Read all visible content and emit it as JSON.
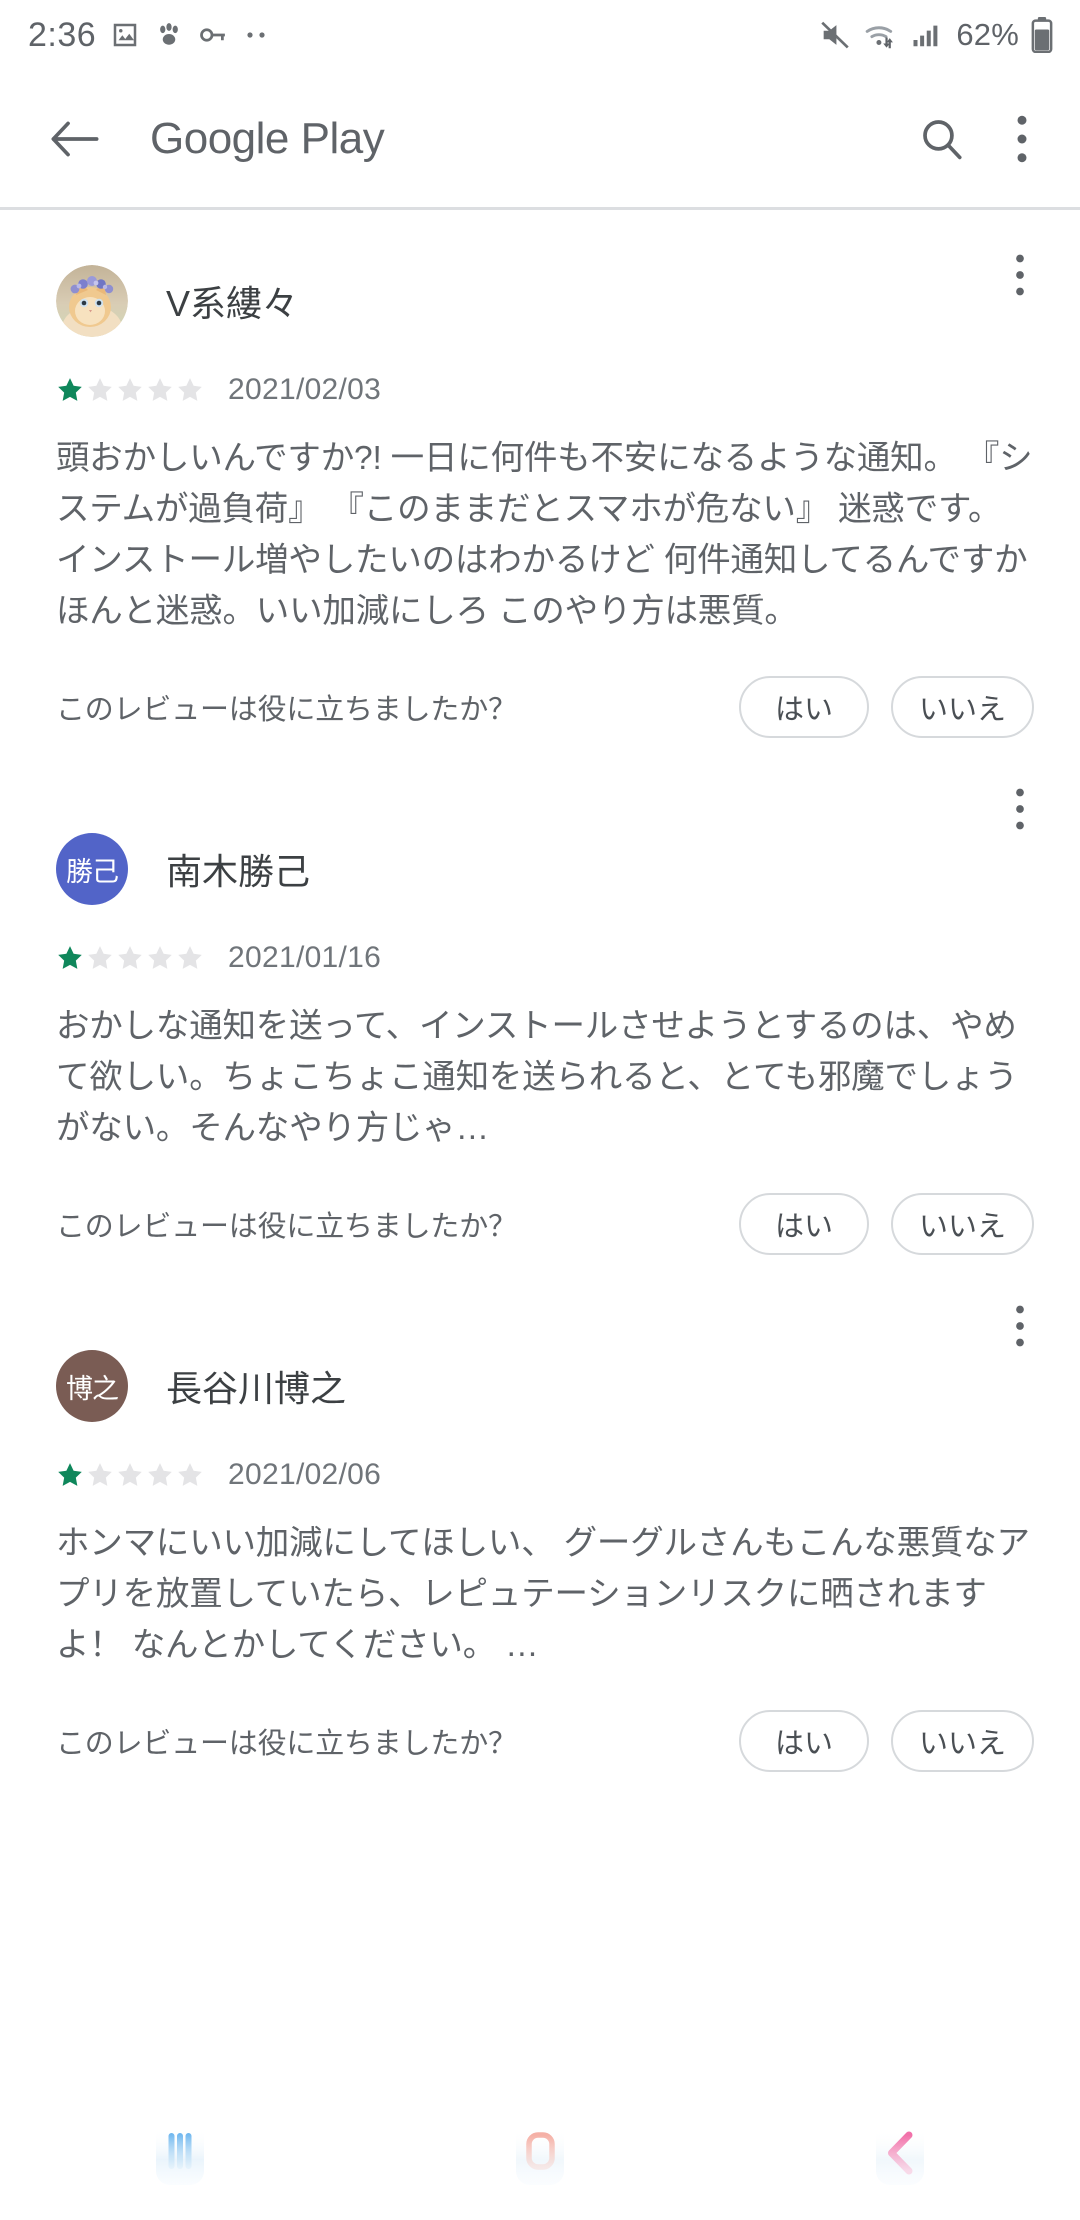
{
  "status_bar": {
    "time": "2:36",
    "battery_percent": "62%",
    "left_icons": [
      "image-icon",
      "paw-icon",
      "key-icon",
      "more-dots-icon"
    ],
    "right_icons": [
      "mute-icon",
      "wifi-icon",
      "signal-icon",
      "battery-icon"
    ]
  },
  "app_bar": {
    "title": "Google Play",
    "back_icon": "back-arrow-icon",
    "search_icon": "search-icon",
    "overflow_icon": "overflow-menu-icon"
  },
  "colors": {
    "star_filled": "#0f875b",
    "star_empty": "#e4e4e6",
    "text_primary": "#3c4043",
    "text_secondary": "#5f6368",
    "divider": "#dcdee1",
    "avatar_2_bg": "#5264c8",
    "avatar_3_bg": "#7a5c54",
    "nav_recents": "#66b2ea",
    "nav_home": "#f0a79c",
    "nav_back": "#f279af"
  },
  "helpful_prompt": "このレビューは役に立ちましたか？",
  "helpful_yes": "はい",
  "helpful_no": "いいえ",
  "reviews": [
    {
      "author": "V系縷々",
      "avatar_type": "photo",
      "avatar_initials": "",
      "rating": 1,
      "max_rating": 5,
      "date": "2021/02/03",
      "text": "頭おかしいんですか?! 一日に何件も不安になるような通知。 『システムが過負荷』 『このままだとスマホが危ない』 迷惑です。 インストール増やしたいのはわかるけど 何件通知してるんですか ほんと迷惑。いい加減にしろ このやり方は悪質。"
    },
    {
      "author": "南木勝己",
      "avatar_type": "initials",
      "avatar_initials": "勝己",
      "rating": 1,
      "max_rating": 5,
      "date": "2021/01/16",
      "text": "おかしな通知を送って、インストールさせようとするのは、やめて欲しい。ちょこちょこ通知を送られると、とても邪魔でしょうがない。そんなやり方じゃ…"
    },
    {
      "author": "長谷川博之",
      "avatar_type": "initials",
      "avatar_initials": "博之",
      "rating": 1,
      "max_rating": 5,
      "date": "2021/02/06",
      "text": "ホンマにいい加減にしてほしい、 グーグルさんもこんな悪質なアプリを放置していたら、レピュテーションリスクに晒されますよ！ なんとかしてください。 …"
    }
  ],
  "nav_bar": {
    "items": [
      {
        "name": "recents-button",
        "icon": "recents-icon"
      },
      {
        "name": "home-button",
        "icon": "home-icon"
      },
      {
        "name": "back-button",
        "icon": "back-chevron-icon"
      }
    ]
  }
}
